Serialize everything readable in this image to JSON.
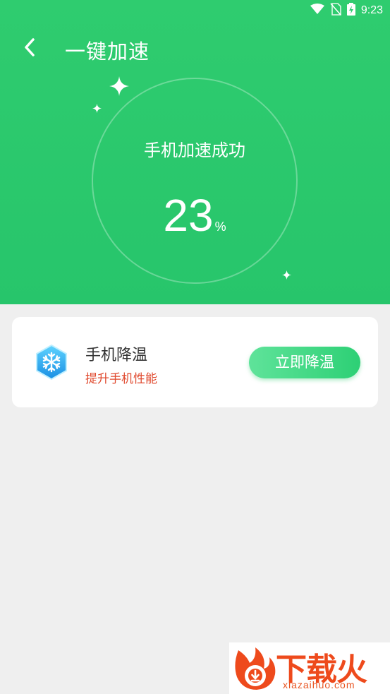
{
  "status_bar": {
    "time": "9:23",
    "icons": [
      "wifi-icon",
      "no-sim-icon",
      "battery-charging-icon"
    ]
  },
  "header": {
    "title": "一键加速",
    "back_icon": "chevron-left-icon",
    "background_color": "#2ecc71"
  },
  "result": {
    "title": "手机加速成功",
    "percent_value": "23",
    "percent_unit": "%"
  },
  "cool_card": {
    "icon": "snowflake-icon",
    "title": "手机降温",
    "subtitle": "提升手机性能",
    "subtitle_color": "#e04a2f",
    "button_label": "立即降温"
  },
  "watermark": {
    "brand": "下载火",
    "url": "xiazaihuo.com",
    "color": "#ee4a1c"
  }
}
